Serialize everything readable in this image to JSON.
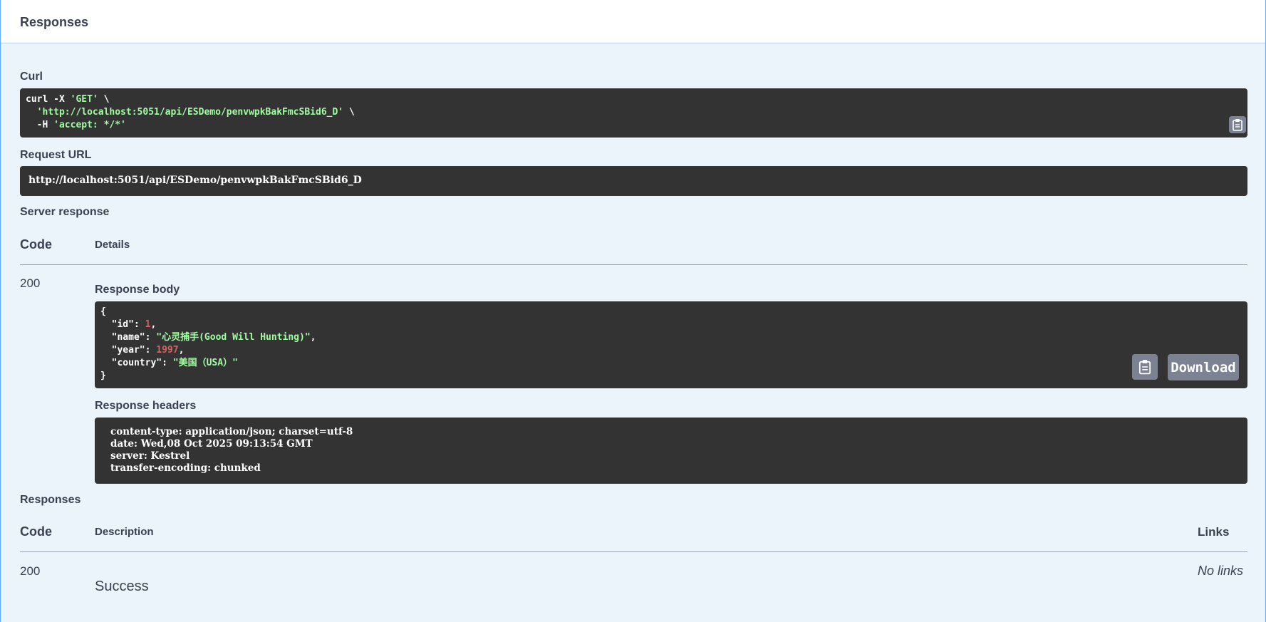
{
  "panel": {
    "title": "Responses"
  },
  "curl": {
    "label": "Curl",
    "line1_cmd": "curl -X ",
    "line1_method": "'GET'",
    "line1_end": " \\",
    "line2_indent": "  ",
    "line2_url": "'http://localhost:5051/api/ESDemo/penvwpkBakFmcSBid6_D'",
    "line2_end": " \\",
    "line3_flag": "  -H ",
    "line3_header": "'accept: */*'"
  },
  "request_url": {
    "label": "Request URL",
    "value": "http://localhost:5051/api/ESDemo/penvwpkBakFmcSBid6_D"
  },
  "server_response": {
    "label": "Server response",
    "col_code": "Code",
    "col_details": "Details",
    "code": "200",
    "body_label": "Response body",
    "body": {
      "open": "{",
      "id_key": "\"id\"",
      "id_val": "1",
      "name_key": "\"name\"",
      "name_val": "\"心灵捕手(Good Will Hunting)\"",
      "year_key": "\"year\"",
      "year_val": "1997",
      "country_key": "\"country\"",
      "country_val": "\"美国（USA）\"",
      "close": "}"
    },
    "download_label": "Download",
    "headers_label": "Response headers",
    "headers": [
      "content-type: application/json; charset=utf-8",
      "date: Wed,08 Oct 2025 09:13:54 GMT",
      "server: Kestrel",
      "transfer-encoding: chunked"
    ]
  },
  "responses": {
    "label": "Responses",
    "col_code": "Code",
    "col_description": "Description",
    "col_links": "Links",
    "code": "200",
    "description": "Success",
    "links": "No links"
  },
  "colors": {
    "panel_border": "#61affe",
    "panel_bg": "#ebf3fb",
    "code_bg": "#333333",
    "string": "#a2fca2",
    "number": "#d36363",
    "button": "#7d8293"
  }
}
